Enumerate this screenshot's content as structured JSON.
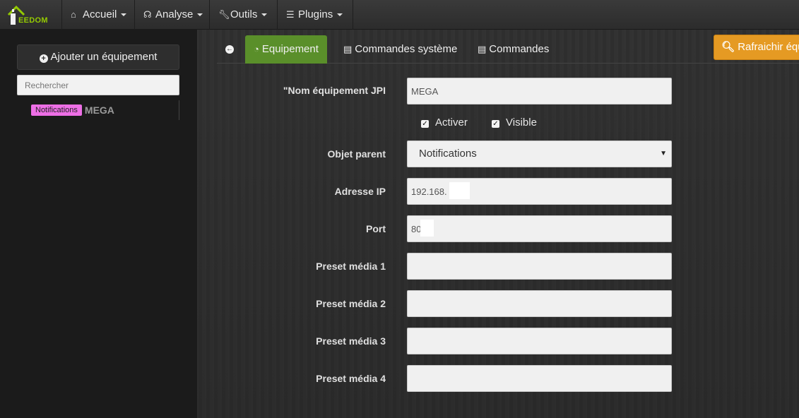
{
  "brand": {
    "logo_text": "EEDOM"
  },
  "navbar": {
    "items": [
      {
        "label": "Accueil",
        "icon": "home-icon"
      },
      {
        "label": "Analyse",
        "icon": "stethoscope-icon"
      },
      {
        "label": "Outils",
        "icon": "wrench-icon"
      },
      {
        "label": "Plugins",
        "icon": "tasks-icon"
      }
    ]
  },
  "sidebar": {
    "add_button_label": "Ajouter un équipement",
    "search_placeholder": "Rechercher",
    "equipments": [
      {
        "badge": "Notifications",
        "name": "MEGA",
        "badge_color": "#ee6fe6"
      }
    ]
  },
  "tabs": {
    "back_icon": "arrow-left-circle-icon",
    "items": [
      {
        "label": "Equipement",
        "icon": "tachometer-icon",
        "active": true
      },
      {
        "label": "Commandes système",
        "icon": "list-alt-icon",
        "active": false
      },
      {
        "label": "Commandes",
        "icon": "list-alt-icon",
        "active": false
      }
    ],
    "refresh_label": "Rafraichir équ"
  },
  "form": {
    "name_label": "\"Nom équipement JPI",
    "name_value": "MEGA",
    "enable_label": "Activer",
    "visible_label": "Visible",
    "parent_label": "Objet parent",
    "parent_value": "Notifications",
    "ip_label": "Adresse IP",
    "ip_value": "192.168.",
    "port_label": "Port",
    "port_value": "80",
    "preset1_label": "Preset média 1",
    "preset2_label": "Preset média 2",
    "preset3_label": "Preset média 3",
    "preset4_label": "Preset média 4"
  },
  "colors": {
    "active_tab": "#5a8f2a",
    "refresh_button": "#e59a23",
    "brand_green": "#94ca02",
    "badge": "#ee6fe6"
  }
}
